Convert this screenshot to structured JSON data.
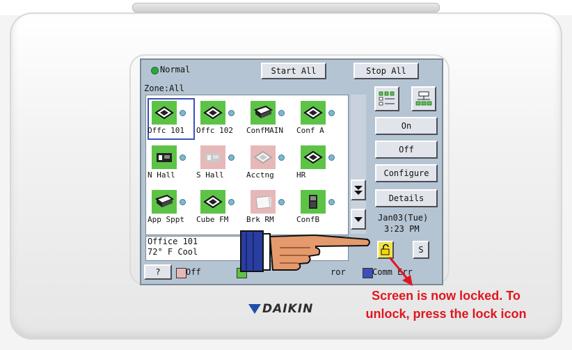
{
  "status": {
    "label": "Normal"
  },
  "toolbar": {
    "start_all": "Start All",
    "stop_all": "Stop All"
  },
  "zone": {
    "label": "Zone:All"
  },
  "units": [
    {
      "label": "Offc 101",
      "state": "on",
      "icon": "cassette-unit-icon",
      "selected": true
    },
    {
      "label": "Offc 102",
      "state": "on",
      "icon": "cassette-unit-icon",
      "selected": false
    },
    {
      "label": "ConfMAIN",
      "state": "on",
      "icon": "ceiling-unit-icon",
      "selected": false
    },
    {
      "label": "Conf A",
      "state": "on",
      "icon": "cassette-unit-icon",
      "selected": false
    },
    {
      "label": "N Hall",
      "state": "on",
      "icon": "wall-unit-icon",
      "selected": false
    },
    {
      "label": "S Hall",
      "state": "off",
      "icon": "wall-unit-icon",
      "selected": false
    },
    {
      "label": "Acctng",
      "state": "off",
      "icon": "cassette-unit-icon",
      "selected": false
    },
    {
      "label": "HR",
      "state": "on",
      "icon": "cassette-unit-icon",
      "selected": false
    },
    {
      "label": "App Sppt",
      "state": "on",
      "icon": "ceiling-unit-icon",
      "selected": false
    },
    {
      "label": "Cube FM",
      "state": "on",
      "icon": "cassette-unit-icon",
      "selected": false
    },
    {
      "label": "Brk RM",
      "state": "off",
      "icon": "panel-unit-icon",
      "selected": false
    },
    {
      "label": "ConfB",
      "state": "on",
      "icon": "floor-unit-icon",
      "selected": false
    }
  ],
  "side": {
    "on": "On",
    "off": "Off",
    "configure": "Configure",
    "details": "Details"
  },
  "clock": {
    "date": "Jan03(Tue)",
    "time": "3:23 PM"
  },
  "info": {
    "name": "Office 101",
    "temp_mode": "72° F  Cool"
  },
  "legend": {
    "help": "?",
    "off": "Off",
    "error_suffix": "ror",
    "comm_err": "Comm Err"
  },
  "sbutton": "S",
  "brand": "DAIKIN",
  "callout": {
    "line1": "Screen is now locked. To",
    "line2": "unlock, press the lock icon"
  },
  "colors": {
    "on": "#5cc346",
    "off": "#e7b8b8",
    "comm_err": "#3c50b7",
    "callout": "#e0161d"
  }
}
